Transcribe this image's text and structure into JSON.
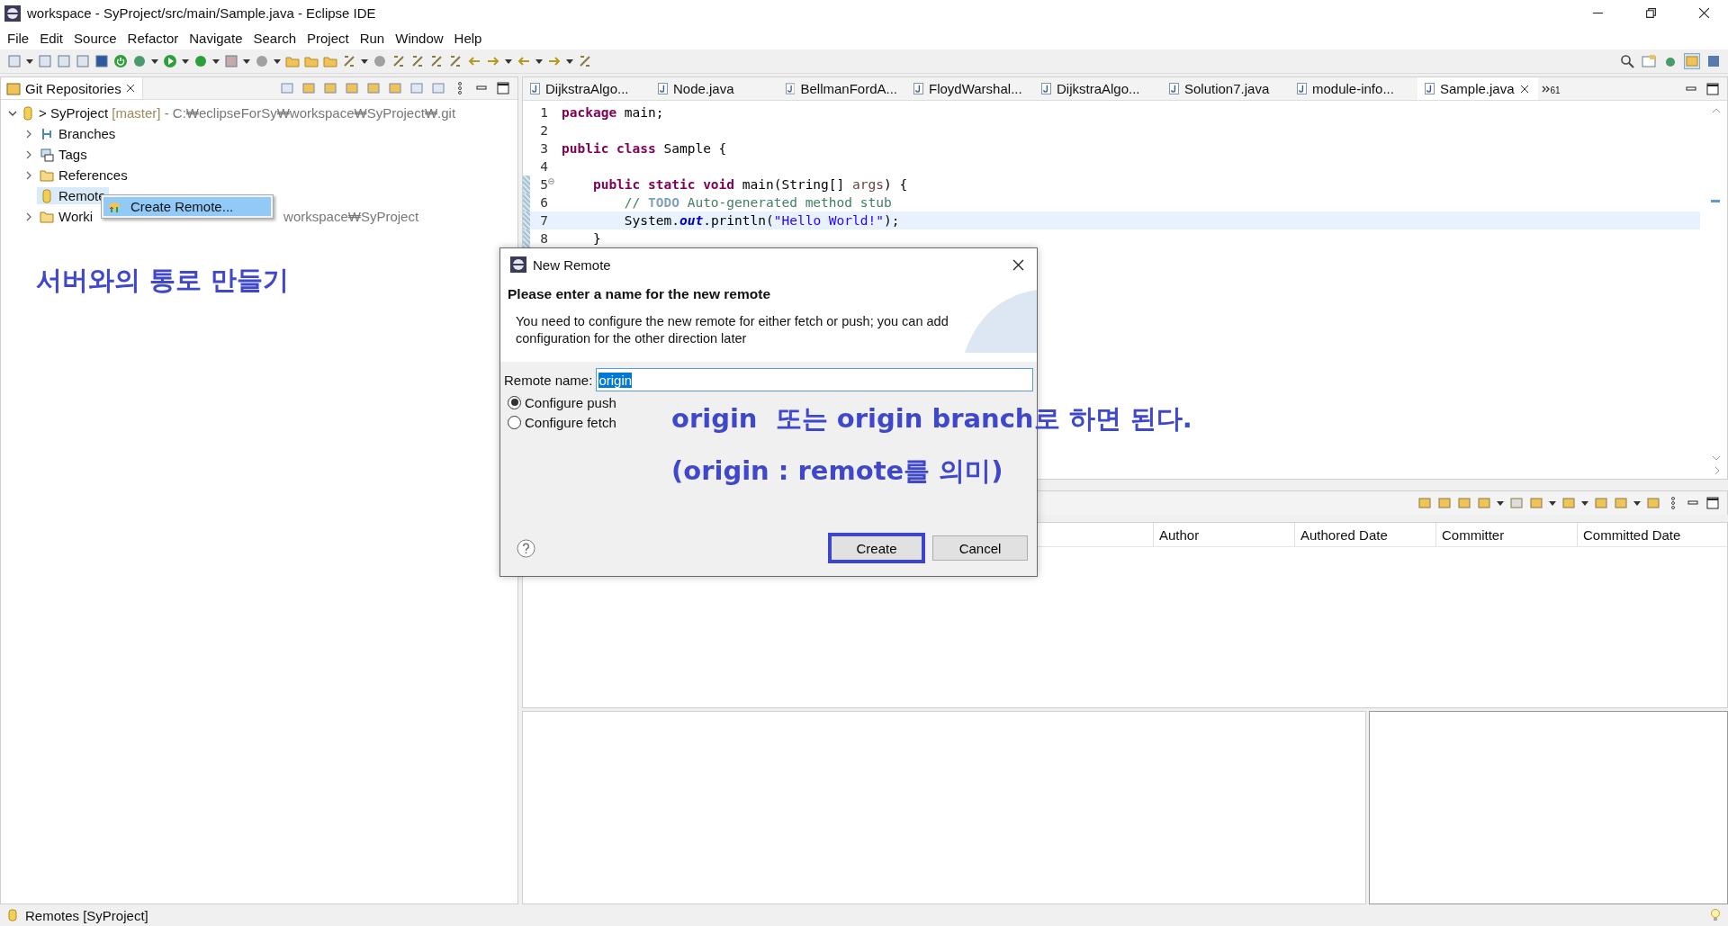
{
  "window": {
    "title": "workspace - SyProject/src/main/Sample.java - Eclipse IDE"
  },
  "menu": [
    "File",
    "Edit",
    "Source",
    "Refactor",
    "Navigate",
    "Search",
    "Project",
    "Run",
    "Window",
    "Help"
  ],
  "git_repositories": {
    "title": "Git Repositories",
    "tree": [
      {
        "prefix": ">",
        "label": "SyProject",
        "branch": "[master]",
        "path": "- C:₩eclipseForSy₩workspace₩SyProject₩.git",
        "expanded": true,
        "children": [
          {
            "label": "Branches",
            "kind": "branches",
            "has_children": true,
            "selected": false
          },
          {
            "label": "Tags",
            "kind": "tags",
            "has_children": true,
            "selected": false
          },
          {
            "label": "References",
            "kind": "folder",
            "has_children": true,
            "selected": false
          },
          {
            "label": "Remote",
            "kind": "remotes",
            "has_children": false,
            "selected": true
          },
          {
            "label": "Worki",
            "after_menu": "workspace₩SyProject",
            "kind": "folder",
            "has_children": true,
            "selected": false
          }
        ]
      }
    ]
  },
  "context_menu": {
    "items": [
      {
        "label": "Create Remote...",
        "selected": true
      }
    ]
  },
  "editor": {
    "tabs": [
      {
        "label": "DijkstraAlgo...",
        "selected": false
      },
      {
        "label": "Node.java",
        "selected": false
      },
      {
        "label": "BellmanFordA...",
        "selected": false
      },
      {
        "label": "FloydWarshal...",
        "selected": false
      },
      {
        "label": "DijkstraAlgo...",
        "selected": false
      },
      {
        "label": "Solution7.java",
        "selected": false
      },
      {
        "label": "module-info...",
        "selected": false
      },
      {
        "label": "Sample.java",
        "selected": true
      }
    ],
    "overflow_count": "61",
    "lines": [
      {
        "number": "1",
        "foldable": false,
        "changed": false,
        "current": false,
        "tokens": [
          {
            "kind": "keyword",
            "text": "package"
          },
          {
            "kind": "plain",
            "text": " main;"
          }
        ]
      },
      {
        "number": "2",
        "foldable": false,
        "changed": false,
        "current": false
      },
      {
        "number": "3",
        "foldable": false,
        "changed": false,
        "current": false,
        "tokens": [
          {
            "kind": "keyword",
            "text": "public class"
          },
          {
            "kind": "plain",
            "text": " Sample {"
          }
        ]
      },
      {
        "number": "4",
        "foldable": false,
        "changed": false,
        "current": false
      },
      {
        "number": "5",
        "foldable": true,
        "changed": true,
        "current": false,
        "tokens": [
          {
            "kind": "keyword",
            "text": "    public static void"
          },
          {
            "kind": "plain",
            "text": " main(String[] "
          },
          {
            "kind": "param",
            "text": "args"
          },
          {
            "kind": "plain",
            "text": ") {"
          }
        ]
      },
      {
        "number": "6",
        "foldable": false,
        "changed": true,
        "current": false,
        "tokens": [
          {
            "kind": "comment",
            "text": "        // "
          },
          {
            "kind": "todo",
            "text": "TODO"
          },
          {
            "kind": "comment",
            "text": " Auto-generated method stub"
          }
        ]
      },
      {
        "number": "7",
        "foldable": false,
        "changed": true,
        "current": true,
        "tokens": [
          {
            "kind": "plain",
            "text": "        System."
          },
          {
            "kind": "field",
            "text": "out"
          },
          {
            "kind": "plain",
            "text": ".println("
          },
          {
            "kind": "string",
            "text": "\"Hello World!\""
          },
          {
            "kind": "plain",
            "text": ");"
          }
        ]
      },
      {
        "number": "8",
        "foldable": false,
        "changed": true,
        "current": false,
        "tokens": [
          {
            "kind": "plain",
            "text": "    }"
          }
        ]
      }
    ]
  },
  "history": {
    "columns": [
      "Author",
      "Authored Date",
      "Committer",
      "Committed Date"
    ]
  },
  "dialog": {
    "title": "New Remote",
    "heading": "Please enter a name for the new remote",
    "description": "You need to configure the new remote for either fetch or push; you can add configuration for the other direction later",
    "field_label": "Remote name:",
    "field_value": "origin",
    "value_selected": true,
    "options": [
      {
        "label": "Configure push",
        "selected": true
      },
      {
        "label": "Configure fetch",
        "selected": false
      }
    ],
    "buttons": [
      {
        "label": "Create",
        "default": true
      },
      {
        "label": "Cancel",
        "default": false
      }
    ]
  },
  "annotations": [
    "서버와의 통로 만들기",
    "origin  또는 origin branch로 하면 된다.",
    "(origin : remote를 의미)"
  ],
  "status_bar": {
    "text": "Remotes [SyProject]"
  }
}
